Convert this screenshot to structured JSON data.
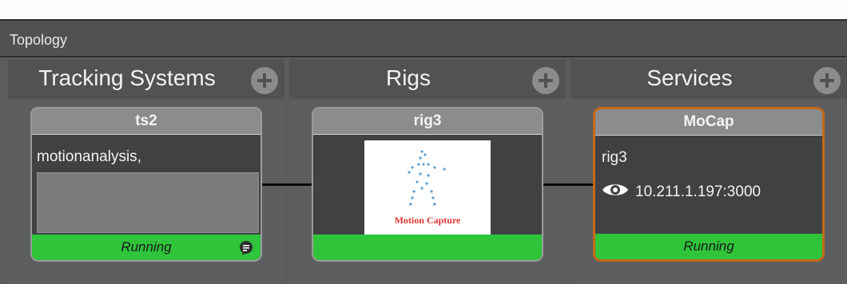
{
  "section": {
    "title": "Topology"
  },
  "columns": [
    {
      "title": "Tracking Systems"
    },
    {
      "title": "Rigs"
    },
    {
      "title": "Services"
    }
  ],
  "cards": {
    "tracking": {
      "name": "ts2",
      "description": "motionanalysis,",
      "status": "Running",
      "icon": "chat-bubble-icon"
    },
    "rig": {
      "name": "rig3",
      "preview_label": "Motion Capture"
    },
    "service": {
      "name": "MoCap",
      "rig": "rig3",
      "endpoint": "10.211.1.197:3000",
      "endpoint_icon": "eye-icon",
      "status": "Running"
    }
  },
  "colors": {
    "running": "#2fc43a",
    "selected_border": "#c46a17",
    "card_header": "#8a8c8e"
  }
}
